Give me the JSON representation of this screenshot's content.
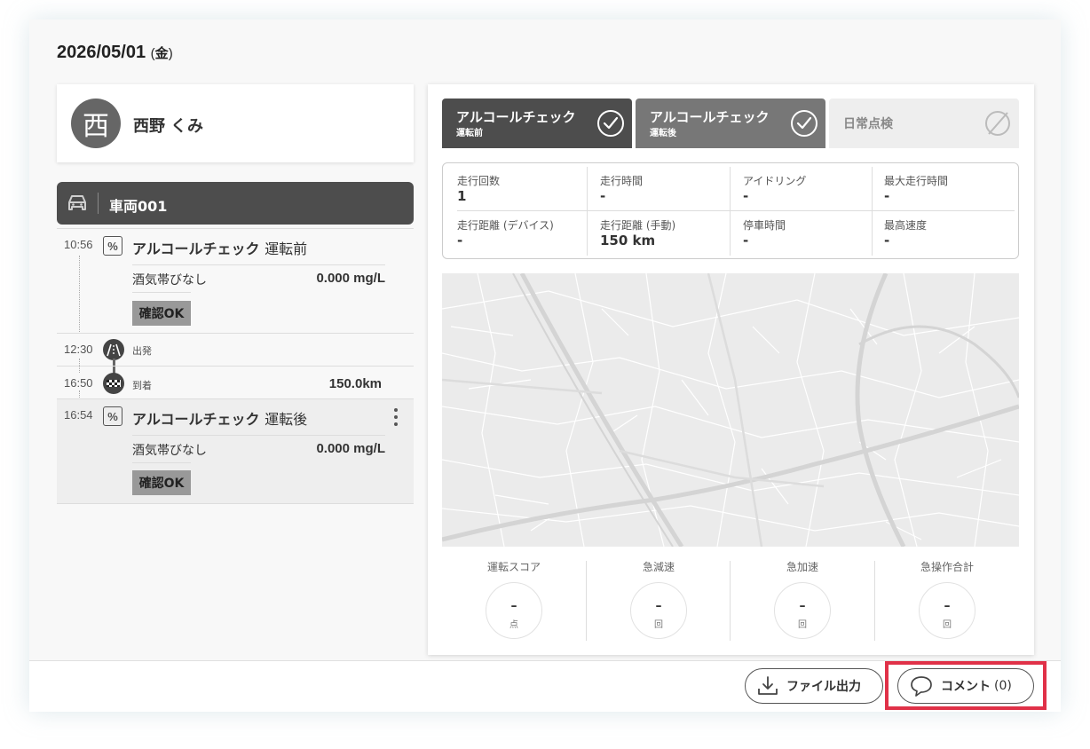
{
  "header": {
    "date": "2026/05/01",
    "dow_open": "(",
    "dow": "金",
    "dow_close": ")"
  },
  "person": {
    "avatar_char": "西",
    "name": "西野 くみ"
  },
  "vehicle": {
    "name": "車両001"
  },
  "timeline": {
    "event1": {
      "time": "10:56",
      "icon_text": "%",
      "title": "アルコールチェック",
      "subtitle": "運転前",
      "label": "酒気帯びなし",
      "value": "0.000 mg/L",
      "badge": "確認OK"
    },
    "departure": {
      "time": "12:30",
      "label": "出発"
    },
    "arrival": {
      "time": "16:50",
      "label": "到着",
      "value": "150.0km"
    },
    "event2": {
      "time": "16:54",
      "icon_text": "%",
      "title": "アルコールチェック",
      "subtitle": "運転後",
      "label": "酒気帯びなし",
      "value": "0.000 mg/L",
      "badge": "確認OK"
    }
  },
  "status_tabs": [
    {
      "title": "アルコールチェック",
      "sub": "運転前",
      "state": "done"
    },
    {
      "title": "アルコールチェック",
      "sub": "運転後",
      "state": "done"
    },
    {
      "title": "日常点検",
      "sub": "",
      "state": "none"
    }
  ],
  "stats": [
    {
      "label": "走行回数",
      "value": "1"
    },
    {
      "label": "走行時間",
      "value": "-"
    },
    {
      "label": "アイドリング",
      "value": "-"
    },
    {
      "label": "最大走行時間",
      "value": "-"
    },
    {
      "label": "走行距離 (デバイス)",
      "value": "-"
    },
    {
      "label": "走行距離 (手動)",
      "value": "150 km"
    },
    {
      "label": "停車時間",
      "value": "-"
    },
    {
      "label": "最高速度",
      "value": "-"
    }
  ],
  "scores": [
    {
      "label": "運転スコア",
      "value": "–",
      "unit": "点"
    },
    {
      "label": "急減速",
      "value": "–",
      "unit": "回"
    },
    {
      "label": "急加速",
      "value": "–",
      "unit": "回"
    },
    {
      "label": "急操作合計",
      "value": "–",
      "unit": "回"
    }
  ],
  "footer": {
    "export_label": "ファイル出力",
    "comment_label": "コメント",
    "comment_count": "(0)"
  },
  "colors": {
    "highlight": "#e03148",
    "tab_dark": "#4d4d4d",
    "tab_mid": "#777777",
    "tab_light": "#eeeeee"
  }
}
